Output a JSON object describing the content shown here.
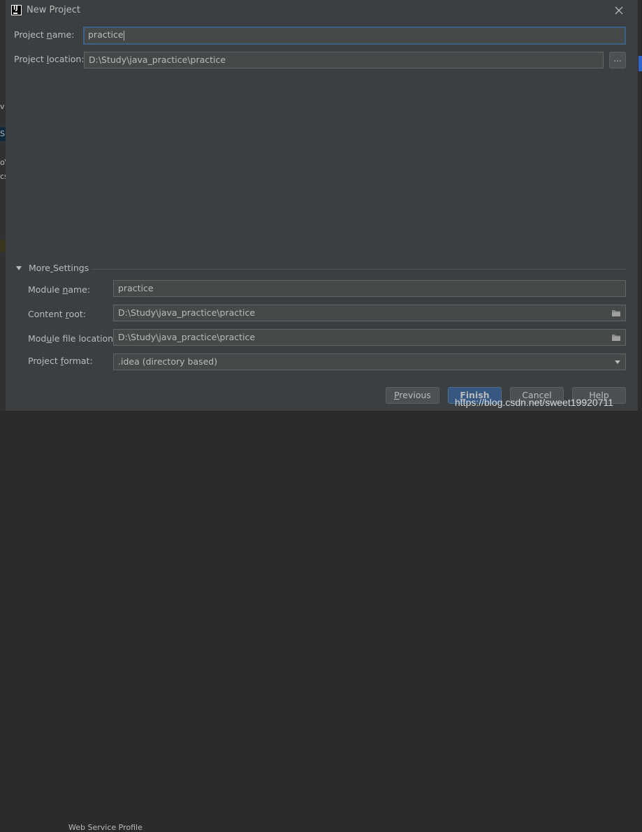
{
  "window": {
    "title": "New Project"
  },
  "background": {
    "fragments": [
      "v",
      "S",
      "o\\",
      "cs"
    ],
    "bottom_text": "Web Service Profile"
  },
  "form": {
    "project_name": {
      "label_pre": "Project ",
      "label_mn": "n",
      "label_post": "ame:",
      "value": "practice"
    },
    "project_location": {
      "label_pre": "Project ",
      "label_mn": "l",
      "label_post": "ocation:",
      "value": "D:\\Study\\java_practice\\practice",
      "browse_label": "..."
    }
  },
  "more_settings": {
    "label_pre": "More",
    "label_mn": " ",
    "label_post": "Settings",
    "label_full": "More Settings",
    "module_name": {
      "label_pre": "Module ",
      "label_mn": "n",
      "label_post": "ame:",
      "value": "practice"
    },
    "content_root": {
      "label_pre": "Content ",
      "label_mn": "r",
      "label_post": "oot:",
      "value": "D:\\Study\\java_practice\\practice"
    },
    "module_file_location": {
      "label_pre": "Mod",
      "label_mn": "u",
      "label_post": "le file location:",
      "value": "D:\\Study\\java_practice\\practice"
    },
    "project_format": {
      "label_pre": "Project ",
      "label_mn": "f",
      "label_post": "ormat:",
      "value": ".idea (directory based)"
    }
  },
  "buttons": {
    "previous": {
      "label_mn": "P",
      "label_post": "revious"
    },
    "finish": {
      "label_mn": "F",
      "label_post": "inish"
    },
    "cancel": {
      "label": "Cancel"
    },
    "help": {
      "label": "Help"
    }
  },
  "watermark": "https://blog.csdn.net/sweet19920711",
  "colors": {
    "dialog_bg": "#3c3f41",
    "field_bg": "#45494a",
    "focus_border": "#3d6185",
    "default_button": "#365880",
    "text": "#bbbbbb"
  }
}
